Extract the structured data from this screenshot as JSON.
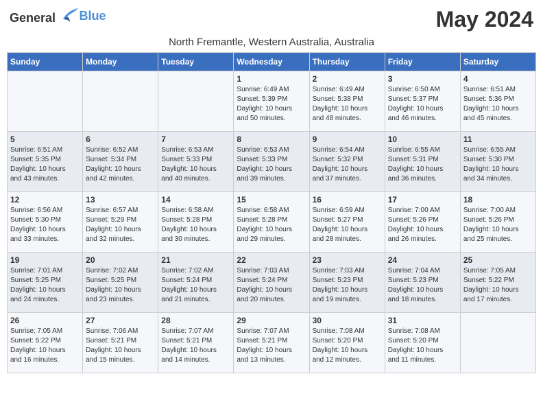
{
  "logo": {
    "general": "General",
    "blue": "Blue"
  },
  "title": {
    "month_year": "May 2024",
    "location": "North Fremantle, Western Australia, Australia"
  },
  "headers": [
    "Sunday",
    "Monday",
    "Tuesday",
    "Wednesday",
    "Thursday",
    "Friday",
    "Saturday"
  ],
  "weeks": [
    [
      {
        "day": "",
        "info": ""
      },
      {
        "day": "",
        "info": ""
      },
      {
        "day": "",
        "info": ""
      },
      {
        "day": "1",
        "info": "Sunrise: 6:49 AM\nSunset: 5:39 PM\nDaylight: 10 hours\nand 50 minutes."
      },
      {
        "day": "2",
        "info": "Sunrise: 6:49 AM\nSunset: 5:38 PM\nDaylight: 10 hours\nand 48 minutes."
      },
      {
        "day": "3",
        "info": "Sunrise: 6:50 AM\nSunset: 5:37 PM\nDaylight: 10 hours\nand 46 minutes."
      },
      {
        "day": "4",
        "info": "Sunrise: 6:51 AM\nSunset: 5:36 PM\nDaylight: 10 hours\nand 45 minutes."
      }
    ],
    [
      {
        "day": "5",
        "info": "Sunrise: 6:51 AM\nSunset: 5:35 PM\nDaylight: 10 hours\nand 43 minutes."
      },
      {
        "day": "6",
        "info": "Sunrise: 6:52 AM\nSunset: 5:34 PM\nDaylight: 10 hours\nand 42 minutes."
      },
      {
        "day": "7",
        "info": "Sunrise: 6:53 AM\nSunset: 5:33 PM\nDaylight: 10 hours\nand 40 minutes."
      },
      {
        "day": "8",
        "info": "Sunrise: 6:53 AM\nSunset: 5:33 PM\nDaylight: 10 hours\nand 39 minutes."
      },
      {
        "day": "9",
        "info": "Sunrise: 6:54 AM\nSunset: 5:32 PM\nDaylight: 10 hours\nand 37 minutes."
      },
      {
        "day": "10",
        "info": "Sunrise: 6:55 AM\nSunset: 5:31 PM\nDaylight: 10 hours\nand 36 minutes."
      },
      {
        "day": "11",
        "info": "Sunrise: 6:55 AM\nSunset: 5:30 PM\nDaylight: 10 hours\nand 34 minutes."
      }
    ],
    [
      {
        "day": "12",
        "info": "Sunrise: 6:56 AM\nSunset: 5:30 PM\nDaylight: 10 hours\nand 33 minutes."
      },
      {
        "day": "13",
        "info": "Sunrise: 6:57 AM\nSunset: 5:29 PM\nDaylight: 10 hours\nand 32 minutes."
      },
      {
        "day": "14",
        "info": "Sunrise: 6:58 AM\nSunset: 5:28 PM\nDaylight: 10 hours\nand 30 minutes."
      },
      {
        "day": "15",
        "info": "Sunrise: 6:58 AM\nSunset: 5:28 PM\nDaylight: 10 hours\nand 29 minutes."
      },
      {
        "day": "16",
        "info": "Sunrise: 6:59 AM\nSunset: 5:27 PM\nDaylight: 10 hours\nand 28 minutes."
      },
      {
        "day": "17",
        "info": "Sunrise: 7:00 AM\nSunset: 5:26 PM\nDaylight: 10 hours\nand 26 minutes."
      },
      {
        "day": "18",
        "info": "Sunrise: 7:00 AM\nSunset: 5:26 PM\nDaylight: 10 hours\nand 25 minutes."
      }
    ],
    [
      {
        "day": "19",
        "info": "Sunrise: 7:01 AM\nSunset: 5:25 PM\nDaylight: 10 hours\nand 24 minutes."
      },
      {
        "day": "20",
        "info": "Sunrise: 7:02 AM\nSunset: 5:25 PM\nDaylight: 10 hours\nand 23 minutes."
      },
      {
        "day": "21",
        "info": "Sunrise: 7:02 AM\nSunset: 5:24 PM\nDaylight: 10 hours\nand 21 minutes."
      },
      {
        "day": "22",
        "info": "Sunrise: 7:03 AM\nSunset: 5:24 PM\nDaylight: 10 hours\nand 20 minutes."
      },
      {
        "day": "23",
        "info": "Sunrise: 7:03 AM\nSunset: 5:23 PM\nDaylight: 10 hours\nand 19 minutes."
      },
      {
        "day": "24",
        "info": "Sunrise: 7:04 AM\nSunset: 5:23 PM\nDaylight: 10 hours\nand 18 minutes."
      },
      {
        "day": "25",
        "info": "Sunrise: 7:05 AM\nSunset: 5:22 PM\nDaylight: 10 hours\nand 17 minutes."
      }
    ],
    [
      {
        "day": "26",
        "info": "Sunrise: 7:05 AM\nSunset: 5:22 PM\nDaylight: 10 hours\nand 16 minutes."
      },
      {
        "day": "27",
        "info": "Sunrise: 7:06 AM\nSunset: 5:21 PM\nDaylight: 10 hours\nand 15 minutes."
      },
      {
        "day": "28",
        "info": "Sunrise: 7:07 AM\nSunset: 5:21 PM\nDaylight: 10 hours\nand 14 minutes."
      },
      {
        "day": "29",
        "info": "Sunrise: 7:07 AM\nSunset: 5:21 PM\nDaylight: 10 hours\nand 13 minutes."
      },
      {
        "day": "30",
        "info": "Sunrise: 7:08 AM\nSunset: 5:20 PM\nDaylight: 10 hours\nand 12 minutes."
      },
      {
        "day": "31",
        "info": "Sunrise: 7:08 AM\nSunset: 5:20 PM\nDaylight: 10 hours\nand 11 minutes."
      },
      {
        "day": "",
        "info": ""
      }
    ]
  ]
}
